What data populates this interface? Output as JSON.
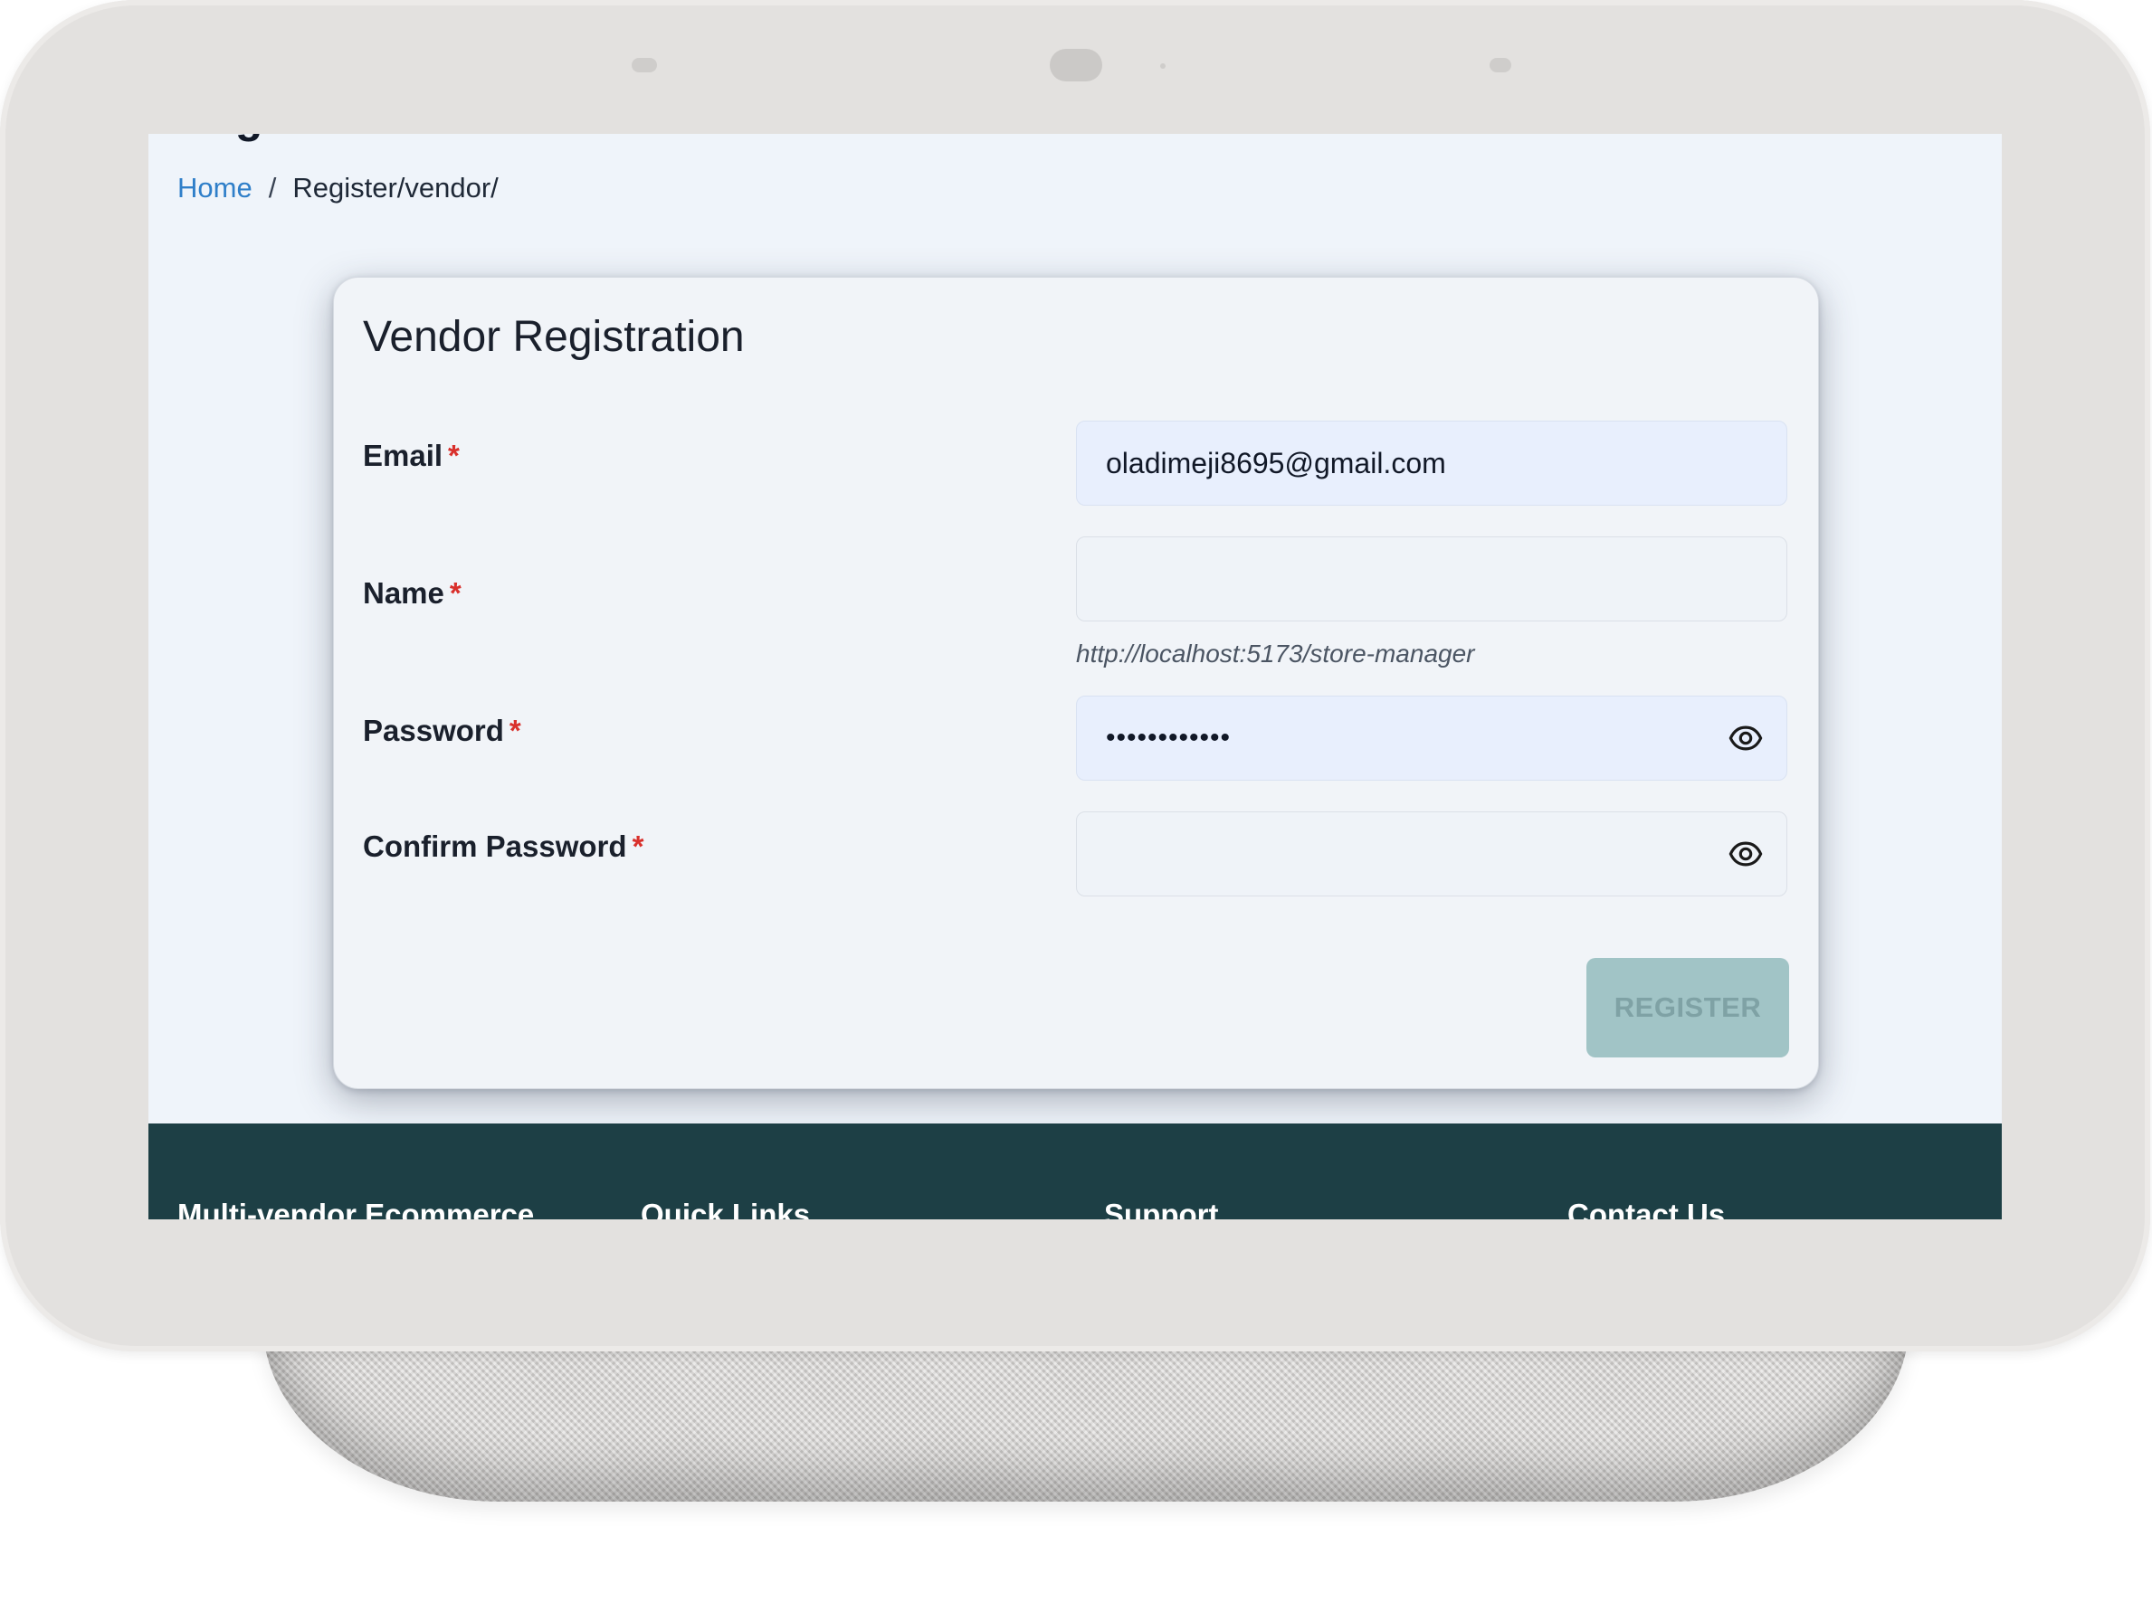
{
  "page": {
    "title_clipped": "Register",
    "breadcrumb": {
      "home": "Home",
      "separator": "/",
      "current": "Register/vendor/"
    }
  },
  "form": {
    "title": "Vendor Registration",
    "required_mark": "*",
    "email": {
      "label": "Email",
      "value": "oladimeji8695@gmail.com"
    },
    "name": {
      "label": "Name",
      "value": "",
      "hint": "http://localhost:5173/store-manager"
    },
    "password": {
      "label": "Password",
      "value_masked": "••••••••••••"
    },
    "confirm_password": {
      "label": "Confirm Password",
      "value_masked": ""
    },
    "submit_label": "REGISTER"
  },
  "footer": {
    "columns": [
      "Multi-vendor Ecommerce",
      "Quick Links",
      "Support",
      "Contact Us"
    ]
  },
  "colors": {
    "link": "#2f7fc9",
    "required": "#d9302c",
    "button_disabled_bg": "#a1c4c6",
    "footer_bg": "#1d3f45"
  }
}
